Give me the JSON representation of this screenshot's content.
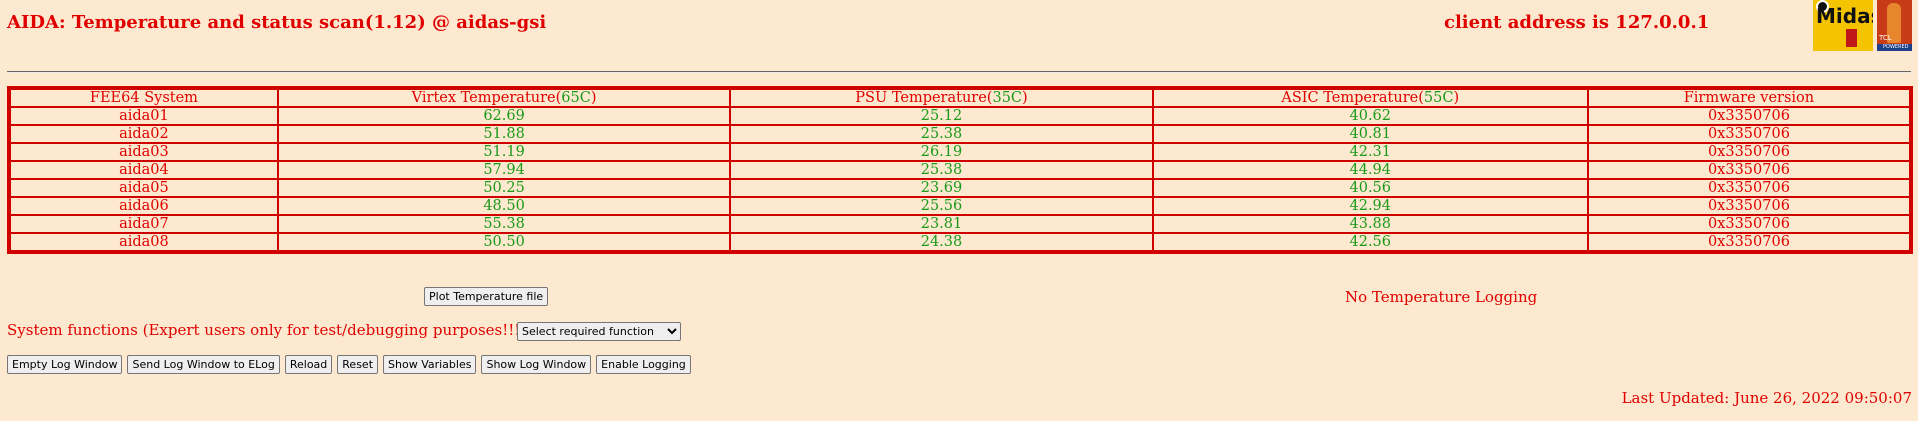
{
  "header": {
    "title": "AIDA: Temperature and status scan(1.12) @ aidas-gsi",
    "client": "client address is 127.0.0.1",
    "logos": {
      "midas_text": "Midas",
      "tcl_text": "TCL",
      "tcl_sub": "POWERED"
    }
  },
  "table": {
    "headers": {
      "system": "FEE64 System",
      "virtex": "Virtex Temperature(",
      "virtex_limit": "65C",
      "psu": "PSU Temperature(",
      "psu_limit": "35C",
      "asic": "ASIC Temperature(",
      "asic_limit": "55C",
      "close": ")",
      "firmware": "Firmware version"
    },
    "rows": [
      {
        "system": "aida01",
        "virtex": "62.69",
        "psu": "25.12",
        "asic": "40.62",
        "firmware": "0x3350706"
      },
      {
        "system": "aida02",
        "virtex": "51.88",
        "psu": "25.38",
        "asic": "40.81",
        "firmware": "0x3350706"
      },
      {
        "system": "aida03",
        "virtex": "51.19",
        "psu": "26.19",
        "asic": "42.31",
        "firmware": "0x3350706"
      },
      {
        "system": "aida04",
        "virtex": "57.94",
        "psu": "25.38",
        "asic": "44.94",
        "firmware": "0x3350706"
      },
      {
        "system": "aida05",
        "virtex": "50.25",
        "psu": "23.69",
        "asic": "40.56",
        "firmware": "0x3350706"
      },
      {
        "system": "aida06",
        "virtex": "48.50",
        "psu": "25.56",
        "asic": "42.94",
        "firmware": "0x3350706"
      },
      {
        "system": "aida07",
        "virtex": "55.38",
        "psu": "23.81",
        "asic": "43.88",
        "firmware": "0x3350706"
      },
      {
        "system": "aida08",
        "virtex": "50.50",
        "psu": "24.38",
        "asic": "42.56",
        "firmware": "0x3350706"
      }
    ]
  },
  "controls": {
    "plot_label": "Plot Temperature file",
    "logging_status": "No Temperature Logging",
    "system_functions_label": "System functions (Expert users only for test/debugging purposes!!!)",
    "select_value": "Select required function"
  },
  "buttons": {
    "empty_log": "Empty Log Window",
    "send_log": "Send Log Window to ELog",
    "reload": "Reload",
    "reset": "Reset",
    "show_variables": "Show Variables",
    "show_log": "Show Log Window",
    "enable_logging": "Enable Logging"
  },
  "footer": {
    "updated": "Last Updated: June 26, 2022 09:50:07"
  },
  "colors": {
    "background": "#fde9cf",
    "text_red": "#e00000",
    "value_green": "#1a9a1a",
    "border_red": "#d00000"
  }
}
